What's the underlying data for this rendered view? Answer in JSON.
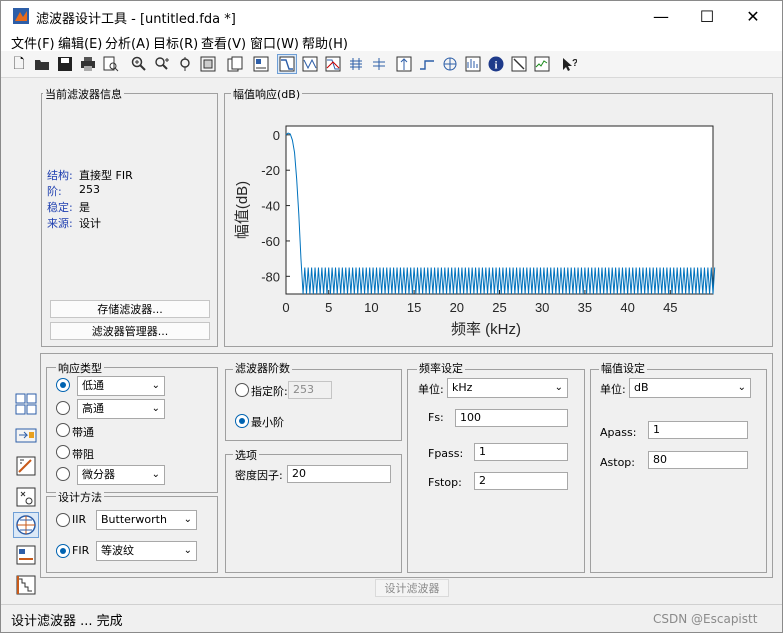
{
  "window": {
    "title": "滤波器设计工具 - [untitled.fda *]",
    "minimize": "—",
    "maximize": "☐",
    "close": "✕"
  },
  "menu": [
    "文件(F)",
    "编辑(E)",
    "分析(A)",
    "目标(R)",
    "查看(V)",
    "窗口(W)",
    "帮助(H)"
  ],
  "toolbar_icons": [
    "new-icon",
    "open-icon",
    "save-icon",
    "print-icon",
    "print-preview-icon",
    "zoom-in-icon",
    "zoom-x-icon",
    "zoom-y-icon",
    "full-view-icon",
    "new-figure-icon",
    "filter-spec-icon",
    "magnitude-response-icon",
    "phase-response-icon",
    "magnitude-phase-icon",
    "group-delay-icon",
    "phase-delay-icon",
    "impulse-response-icon",
    "step-response-icon",
    "pole-zero-icon",
    "coefficients-icon",
    "info-icon",
    "magnitude-estimate-icon",
    "noise-psd-icon",
    "whats-this-icon"
  ],
  "filter_info": {
    "group_label": "当前滤波器信息",
    "structure_label": "结构:",
    "structure": "直接型 FIR",
    "order_label": "阶:",
    "order": "253",
    "stable_label": "稳定:",
    "stable": "是",
    "source_label": "来源:",
    "source": "设计",
    "store_button": "存储滤波器...",
    "manager_button": "滤波器管理器..."
  },
  "plot": {
    "group_label": "幅值响应(dB)",
    "colors": {
      "line": "#0072bd"
    }
  },
  "chart_data": {
    "type": "line",
    "title": "",
    "xlabel": "频率 (kHz)",
    "ylabel": "幅值(dB)",
    "xlim": [
      0,
      50
    ],
    "ylim": [
      -90,
      5
    ],
    "xticks": [
      "0",
      "5",
      "10",
      "15",
      "20",
      "25",
      "30",
      "35",
      "40",
      "45"
    ],
    "yticks": [
      "0",
      "-20",
      "-40",
      "-60",
      "-80"
    ],
    "grid": false,
    "series": [
      {
        "passband": {
          "x": [
            0,
            0.25,
            0.5,
            0.75,
            1.0,
            1.25,
            1.5,
            1.75,
            2.0
          ],
          "y": [
            0,
            1,
            0.5,
            -3,
            -10,
            -25,
            -45,
            -70,
            -90
          ]
        },
        "stopband": {
          "x_start": 2.0,
          "x_end": 50,
          "lobe_top": -75,
          "floor": -90,
          "lobe_width": 0.4
        }
      }
    ]
  },
  "response_type": {
    "group_label": "响应类型",
    "options": [
      {
        "label": "低通",
        "selected": true,
        "has_dropdown": true,
        "dropdown_value": "低通"
      },
      {
        "label": "高通",
        "selected": false,
        "has_dropdown": true,
        "dropdown_value": "高通"
      },
      {
        "label": "带通",
        "selected": false,
        "has_dropdown": false
      },
      {
        "label": "带阻",
        "selected": false,
        "has_dropdown": false
      },
      {
        "label": "微分器",
        "selected": false,
        "has_dropdown": true,
        "dropdown_value": "微分器"
      }
    ]
  },
  "design_method": {
    "group_label": "设计方法",
    "iir_label": "IIR",
    "iir_value": "Butterworth",
    "fir_label": "FIR",
    "fir_value": "等波纹"
  },
  "filter_order": {
    "group_label": "滤波器阶数",
    "specify_label": "指定阶:",
    "specify_value": "253",
    "minimum_label": "最小阶"
  },
  "options": {
    "group_label": "选项",
    "density_label": "密度因子:",
    "density_value": "20"
  },
  "freq_spec": {
    "group_label": "频率设定",
    "units_label": "单位:",
    "units_value": "kHz",
    "fs_label": "Fs:",
    "fs_value": "100",
    "fpass_label": "Fpass:",
    "fpass_value": "1",
    "fstop_label": "Fstop:",
    "fstop_value": "2"
  },
  "mag_spec": {
    "group_label": "幅值设定",
    "units_label": "单位:",
    "units_value": "dB",
    "apass_label": "Apass:",
    "apass_value": "1",
    "astop_label": "Astop:",
    "astop_value": "80"
  },
  "design_button": "设计滤波器",
  "status": "设计滤波器 ... 完成",
  "watermark": "CSDN @Escapistt"
}
